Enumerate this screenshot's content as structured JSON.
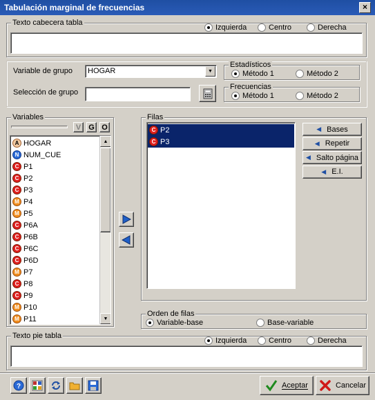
{
  "window": {
    "title": "Tabulación marginal de frecuencias",
    "close": "×"
  },
  "header_text": {
    "group_label": "Texto cabecera tabla",
    "align_options": [
      "Izquierda",
      "Centro",
      "Derecha"
    ],
    "selected": "Izquierda",
    "value": ""
  },
  "group_var": {
    "label": "Variable de grupo",
    "value": "HOGAR"
  },
  "group_sel": {
    "label": "Selección de grupo",
    "value": ""
  },
  "estadisticos": {
    "label": "Estadísticos",
    "opt1": "Método 1",
    "opt2": "Método 2",
    "selected": "Método 1"
  },
  "frecuencias": {
    "label": "Frecuencias",
    "opt1": "Método 1",
    "opt2": "Método 2",
    "selected": "Método 1"
  },
  "variables": {
    "label": "Variables",
    "filter_buttons": [
      "V",
      "G",
      "O"
    ],
    "items": [
      {
        "type": "A",
        "name": "HOGAR"
      },
      {
        "type": "N",
        "name": "NUM_CUE"
      },
      {
        "type": "C",
        "name": "P1"
      },
      {
        "type": "C",
        "name": "P2"
      },
      {
        "type": "C",
        "name": "P3"
      },
      {
        "type": "M",
        "name": "P4"
      },
      {
        "type": "M",
        "name": "P5"
      },
      {
        "type": "C",
        "name": "P6A"
      },
      {
        "type": "C",
        "name": "P6B"
      },
      {
        "type": "C",
        "name": "P6C"
      },
      {
        "type": "C",
        "name": "P6D"
      },
      {
        "type": "M",
        "name": "P7"
      },
      {
        "type": "C",
        "name": "P8"
      },
      {
        "type": "C",
        "name": "P9"
      },
      {
        "type": "M",
        "name": "P10"
      },
      {
        "type": "M",
        "name": "P11"
      }
    ]
  },
  "filas": {
    "label": "Filas",
    "items": [
      {
        "type": "C",
        "name": "P2"
      },
      {
        "type": "C",
        "name": "P3"
      }
    ]
  },
  "side_buttons": [
    "Bases",
    "Repetir",
    "Salto página",
    "E.I."
  ],
  "orden": {
    "label": "Orden de filas",
    "opt1": "Variable-base",
    "opt2": "Base-variable",
    "selected": "Variable-base"
  },
  "footer_text": {
    "group_label": "Texto pie tabla",
    "align_options": [
      "Izquierda",
      "Centro",
      "Derecha"
    ],
    "selected": "Izquierda",
    "value": ""
  },
  "actions": {
    "accept": "Aceptar",
    "cancel": "Cancelar"
  },
  "colors": {
    "titlebar": "#2a5bb7",
    "selection": "#0a246a"
  }
}
